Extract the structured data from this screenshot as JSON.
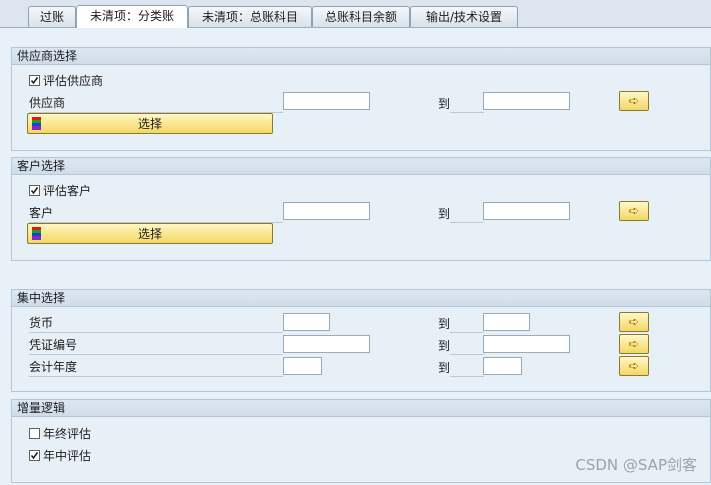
{
  "tabs": [
    {
      "label": "过账"
    },
    {
      "label": "未清项：分类账"
    },
    {
      "label": "未清项：总账科目"
    },
    {
      "label": "总账科目余额"
    },
    {
      "label": "输出/技术设置"
    }
  ],
  "vendor_group": {
    "title": "供应商选择",
    "eval_checkbox_label": "评估供应商",
    "eval_checked": true,
    "field_label": "供应商",
    "from_value": "",
    "to_label": "到",
    "to_value": "",
    "select_button": "选择"
  },
  "customer_group": {
    "title": "客户选择",
    "eval_checkbox_label": "评估客户",
    "eval_checked": true,
    "field_label": "客户",
    "from_value": "",
    "to_label": "到",
    "to_value": "",
    "select_button": "选择"
  },
  "central_group": {
    "title": "集中选择",
    "rows": [
      {
        "label": "货币",
        "from_value": "",
        "to_label": "到",
        "to_value": ""
      },
      {
        "label": "凭证编号",
        "from_value": "",
        "to_label": "到",
        "to_value": ""
      },
      {
        "label": "会计年度",
        "from_value": "",
        "to_label": "到",
        "to_value": ""
      }
    ]
  },
  "logic_group": {
    "title": "增量逻辑",
    "options": [
      {
        "label": "年终评估",
        "checked": false
      },
      {
        "label": "年中评估",
        "checked": true
      }
    ]
  },
  "watermark": "CSDN @SAP剑客",
  "colors": {
    "button_yellow": "#f4d765",
    "group_border": "#b4c7d8",
    "background": "#e8f0f8"
  }
}
